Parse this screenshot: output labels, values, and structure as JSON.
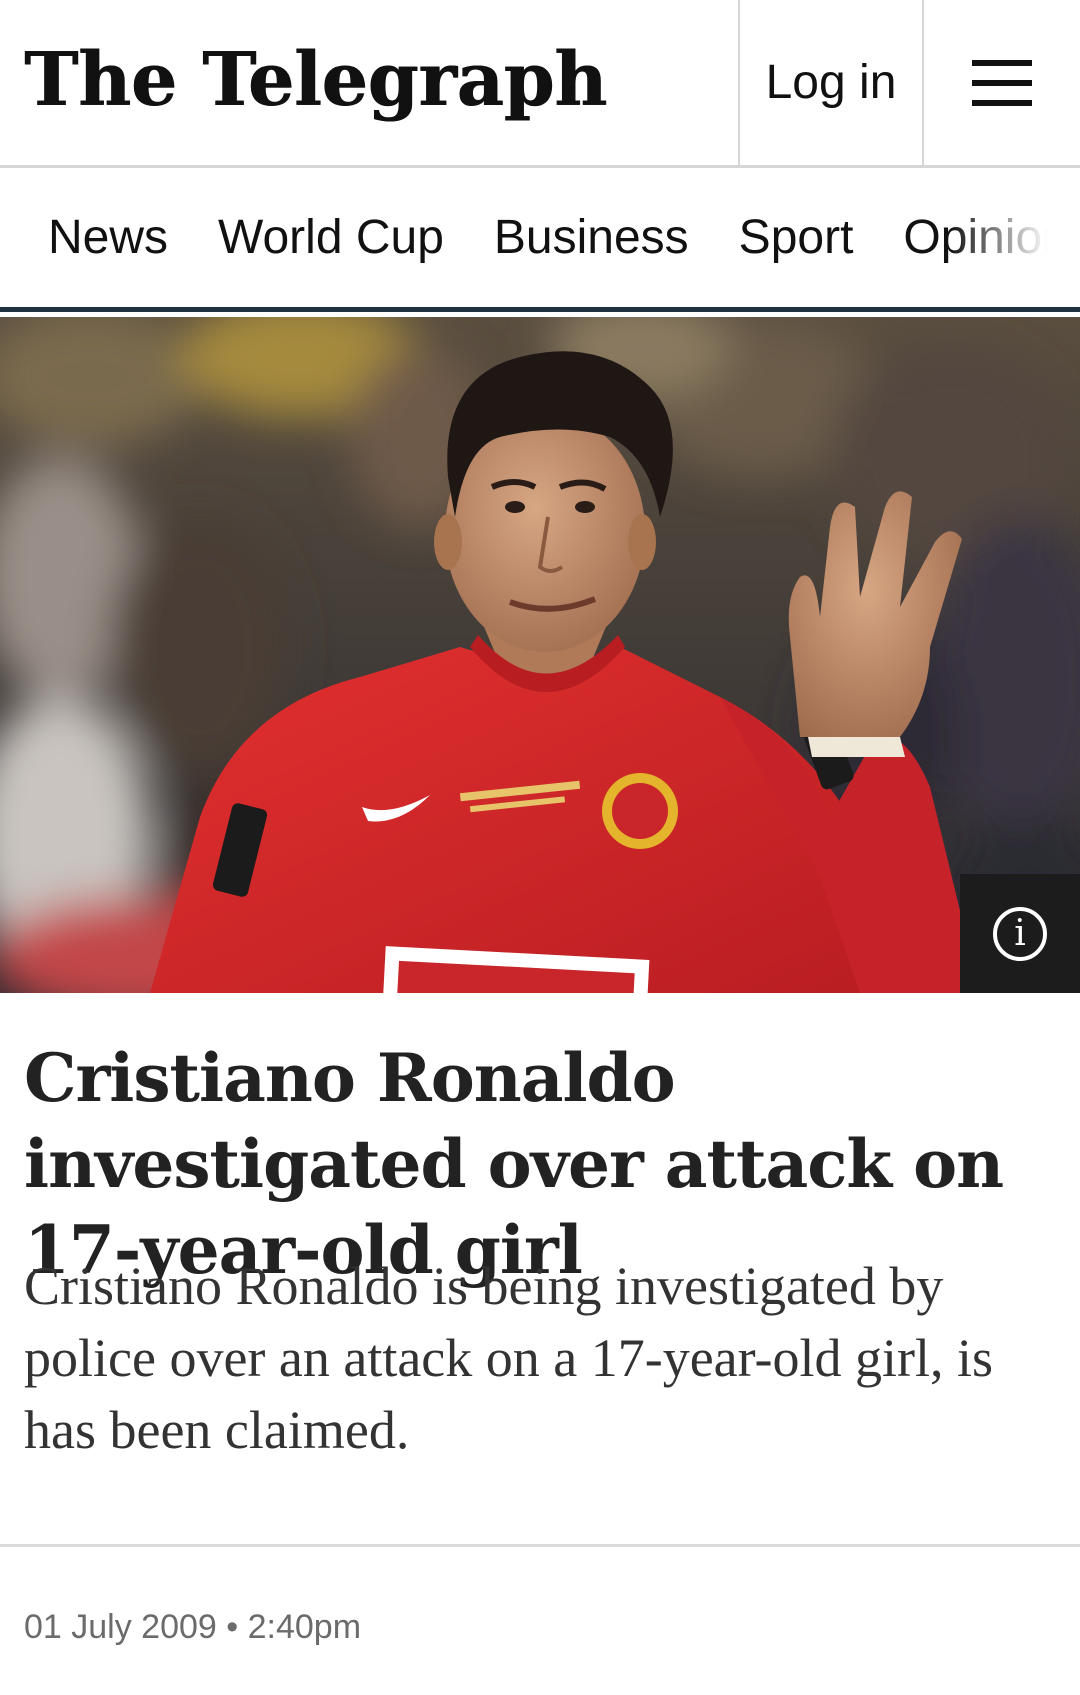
{
  "header": {
    "logo": "The Telegraph",
    "login_label": "Log in"
  },
  "nav": {
    "items": [
      "News",
      "World Cup",
      "Business",
      "Sport",
      "Opinion"
    ]
  },
  "hero": {
    "image_subject": "footballer in red shirt waving",
    "info_icon": "info-icon"
  },
  "article": {
    "headline": "Cristiano Ronaldo investigated over attack on 17-year-old girl",
    "standfirst": "Cristiano Ronaldo is being investigated by police over an attack on a 17-year-old girl, is has been claimed.",
    "date": "01 July 2009",
    "separator": "•",
    "time": "2:40pm"
  },
  "colors": {
    "nav_rule": "#1f3141",
    "shirt_red": "#d8262a",
    "info_button_bg": "#1c1c1c"
  }
}
